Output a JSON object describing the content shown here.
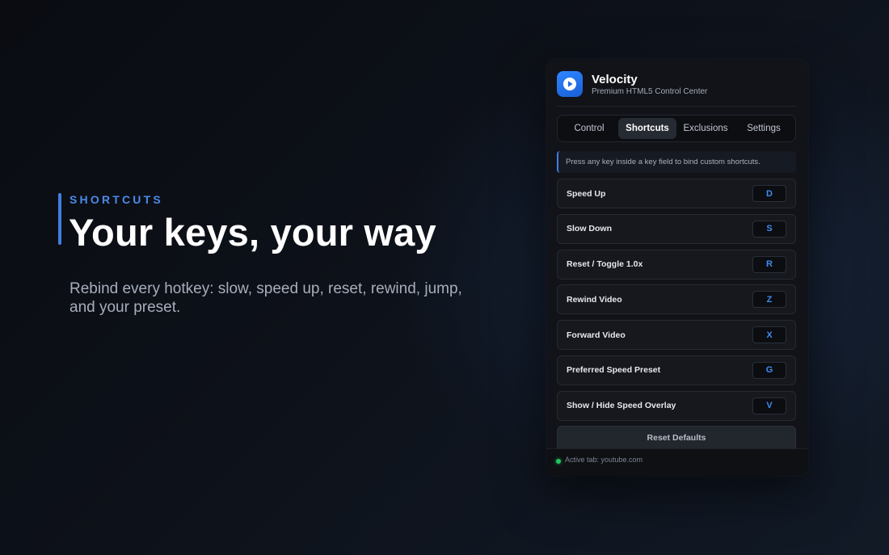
{
  "hero": {
    "eyebrow": "SHORTCUTS",
    "title": "Your keys, your way",
    "description": "Rebind every hotkey: slow, speed up, reset, rewind, jump, and your preset."
  },
  "app": {
    "title": "Velocity",
    "subtitle": "Premium HTML5 Control Center",
    "logo_icon": "play-icon",
    "accent": "#2f86ff"
  },
  "tabs": [
    {
      "label": "Control",
      "active": false
    },
    {
      "label": "Shortcuts",
      "active": true
    },
    {
      "label": "Exclusions",
      "active": false
    },
    {
      "label": "Settings",
      "active": false
    }
  ],
  "info": "Press any key inside a key field to bind custom shortcuts.",
  "shortcuts": [
    {
      "label": "Speed Up",
      "key": "D"
    },
    {
      "label": "Slow Down",
      "key": "S"
    },
    {
      "label": "Reset / Toggle 1.0x",
      "key": "R"
    },
    {
      "label": "Rewind Video",
      "key": "Z"
    },
    {
      "label": "Forward Video",
      "key": "X"
    },
    {
      "label": "Preferred Speed Preset",
      "key": "G"
    },
    {
      "label": "Show / Hide Speed Overlay",
      "key": "V"
    }
  ],
  "reset_label": "Reset Defaults",
  "footer": {
    "status_text": "Active tab: youtube.com",
    "status_color": "#22c55e"
  }
}
